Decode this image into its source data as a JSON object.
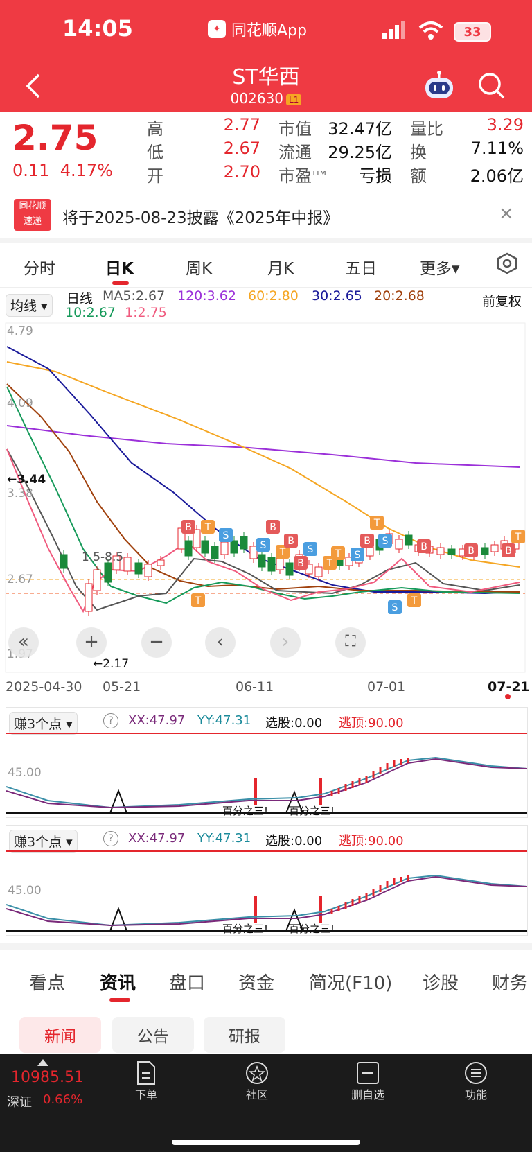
{
  "status": {
    "time": "14:05",
    "app_name": "同花顺App",
    "battery": "33"
  },
  "header": {
    "title": "ST华西",
    "code": "002630",
    "level": "L1"
  },
  "quote": {
    "price": "2.75",
    "change": "0.11",
    "change_pct": "4.17%",
    "high_label": "高",
    "high": "2.77",
    "low_label": "低",
    "low": "2.67",
    "open_label": "开",
    "open": "2.70",
    "mktcap_label": "市值",
    "mktcap": "32.47亿",
    "float_label": "流通",
    "float": "29.25亿",
    "pe_label": "市盈",
    "pe_sup": "TTM",
    "pe": "亏损",
    "vol_ratio_label": "量比",
    "vol_ratio": "3.29",
    "turnover_label": "换",
    "turnover": "7.11%",
    "amount_label": "额",
    "amount": "2.06亿"
  },
  "notice": {
    "logo_top": "同花顺",
    "logo_bottom": "速递",
    "text": "将于2025-08-23披露《2025年中报》",
    "close": "×"
  },
  "chart_tabs": [
    "分时",
    "日K",
    "周K",
    "月K",
    "五日",
    "更多▾"
  ],
  "ma_bar": {
    "selector": "均线 ▾",
    "type": "日线",
    "ma5": "MA5:2.67",
    "ma120": "120:3.62",
    "ma60": "60:2.80",
    "ma30": "30:2.65",
    "ma20": "20:2.68",
    "ma10": "10:2.67",
    "ma1": "1:2.75",
    "adjust": "前复权"
  },
  "colors": {
    "brand": "#ef3a43",
    "ma5": "#555555",
    "ma120": "#9b30d9",
    "ma60": "#f5a623",
    "ma30": "#1a1a9a",
    "ma20": "#a0410d",
    "ma10": "#169a5a",
    "ma1": "#f05a7e",
    "up": "#e4262d",
    "down": "#1a8a3a"
  },
  "kline": {
    "y_labels": [
      "4.79",
      "4.09",
      "3.38",
      "2.67",
      "1.97"
    ],
    "x_labels": [
      "2025-04-30",
      "05-21",
      "06-11",
      "07-01",
      "07-21"
    ],
    "hi_marker": "←3.44",
    "lo_marker": "←2.17",
    "annotation": "1.5-8.5"
  },
  "chart_controls": [
    "«",
    "+",
    "−",
    "‹",
    "›",
    "⛶"
  ],
  "indicator1": {
    "selector": "赚3个点 ▾",
    "help": "?",
    "xx": "XX:47.97",
    "yy": "YY:47.31",
    "pick": "选股:0.00",
    "top": "逃顶:90.00",
    "level": "45.00",
    "note1": "百分之三!",
    "note2": "百分之三!"
  },
  "indicator2": {
    "selector": "赚3个点 ▾",
    "help": "?",
    "xx": "XX:47.97",
    "yy": "YY:47.31",
    "pick": "选股:0.00",
    "top": "逃顶:90.00",
    "level": "45.00",
    "note1": "百分之三!",
    "note2": "百分之三!"
  },
  "bottom_tabs": [
    "看点",
    "资讯",
    "盘口",
    "资金",
    "简况(F10)",
    "诊股",
    "财务"
  ],
  "news_buttons": [
    "新闻",
    "公告",
    "研报"
  ],
  "footer": {
    "index_value": "10985.51",
    "index_name": "深证",
    "index_pct": "0.66%",
    "items": [
      "下单",
      "社区",
      "删自选",
      "功能"
    ]
  }
}
